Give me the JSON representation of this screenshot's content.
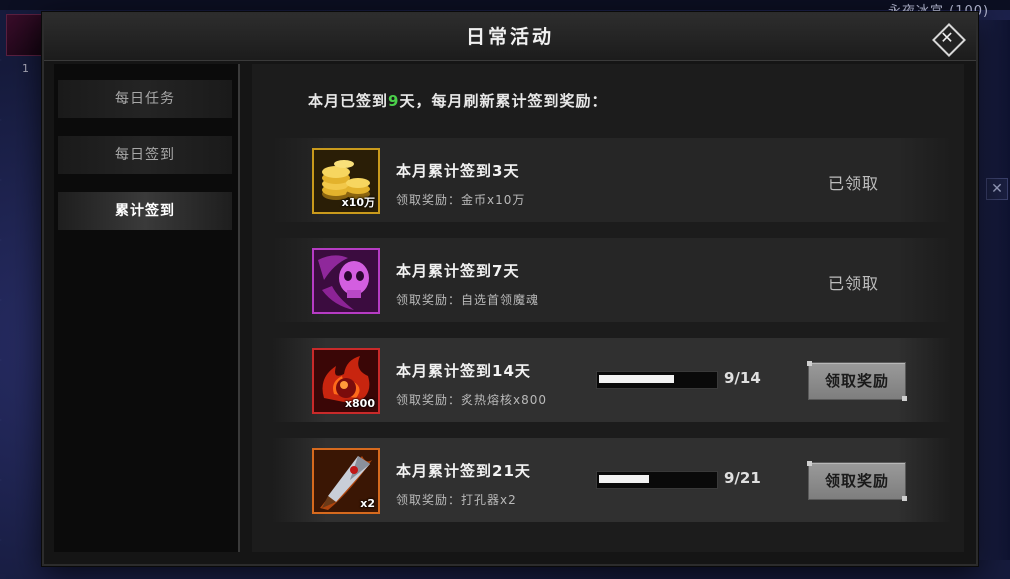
{
  "background": {
    "zone_label": "永夜冰宫 (100)",
    "avatar_level": "1"
  },
  "modal": {
    "title": "日常活动"
  },
  "sidebar": {
    "tabs": [
      {
        "label": "每日任务",
        "active": false
      },
      {
        "label": "每日签到",
        "active": false
      },
      {
        "label": "累计签到",
        "active": true
      }
    ]
  },
  "summary": {
    "prefix": "本月已签到",
    "days": "9",
    "suffix": "天，每月刷新累计签到奖励："
  },
  "rewards": [
    {
      "title": "本月累计签到3天",
      "reward": "领取奖励：金币x10万",
      "qty": "x10万",
      "icon": "gold-coins-icon",
      "status": "已领取"
    },
    {
      "title": "本月累计签到7天",
      "reward": "领取奖励：自选首领魔魂",
      "qty": "",
      "icon": "skull-soul-icon",
      "status": "已领取"
    },
    {
      "title": "本月累计签到14天",
      "reward": "领取奖励：炙热熔核x800",
      "qty": "x800",
      "icon": "fire-core-icon",
      "progress_text": "9/14",
      "progress": 0.643,
      "button": "领取奖励"
    },
    {
      "title": "本月累计签到21天",
      "reward": "领取奖励：打孔器x2",
      "qty": "x2",
      "icon": "drill-icon",
      "progress_text": "9/21",
      "progress": 0.429,
      "button": "领取奖励"
    }
  ],
  "colors": {
    "highlight_days": "#4bd04b",
    "gold_border": "#c99a1c",
    "purple_border": "#b63cc4",
    "red_border": "#c92a2a",
    "orange_border": "#d66a1e"
  }
}
